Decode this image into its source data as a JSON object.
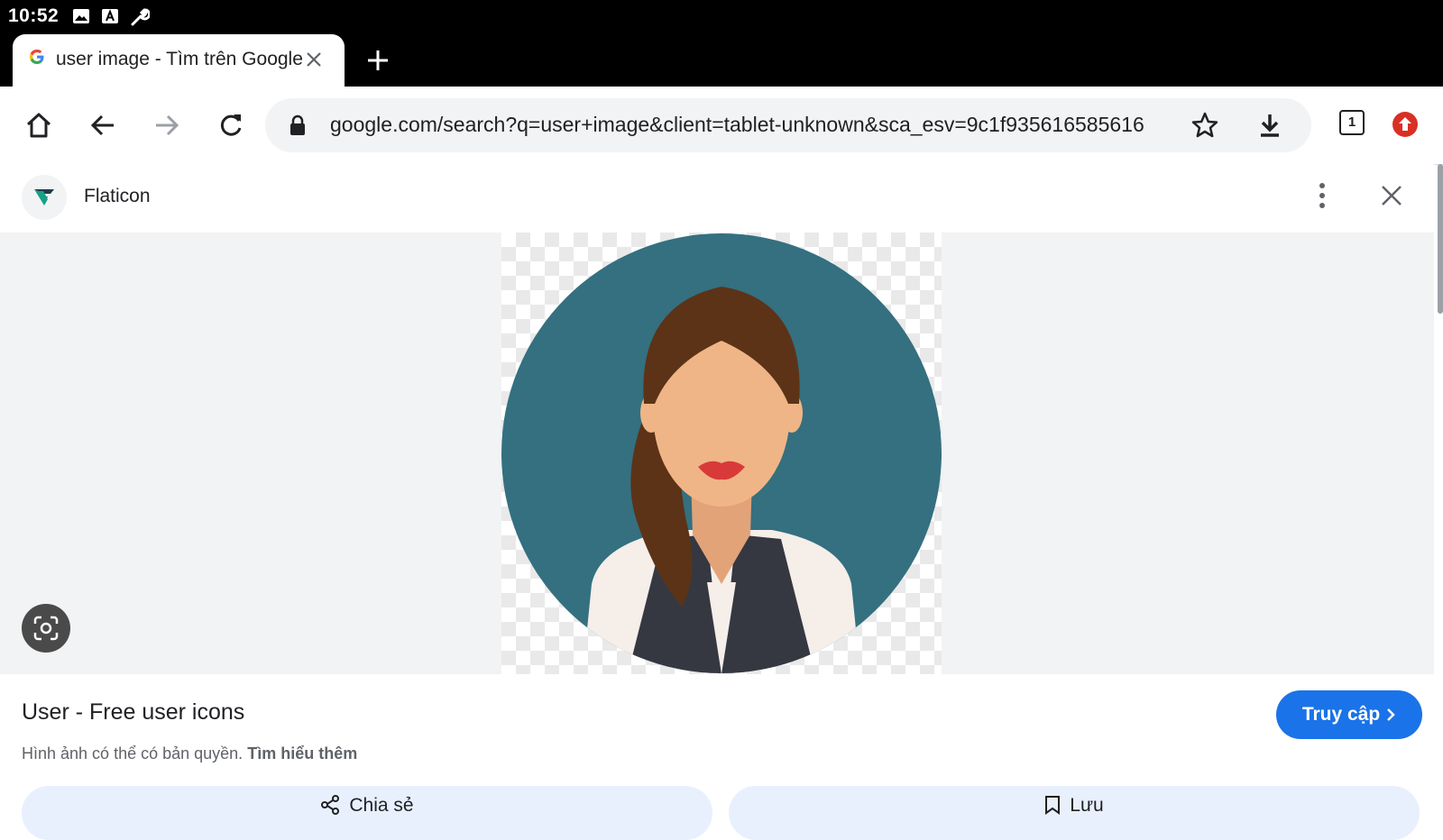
{
  "status": {
    "time": "10:52",
    "icons": [
      "image-icon",
      "font-icon",
      "wrench-icon"
    ]
  },
  "tab": {
    "title": "user image - Tìm trên Google",
    "favicon": "google-g-icon"
  },
  "toolbar": {
    "url": "google.com/search?q=user+image&client=tablet-unknown&sca_esv=9c1f935616585616",
    "tab_count": "1"
  },
  "site": {
    "name": "Flaticon"
  },
  "image_info": {
    "title": "User - Free user icons",
    "copyright_text": "Hình ảnh có thể có bản quyền.",
    "learn_more": "Tìm hiểu thêm",
    "visit_label": "Truy cập"
  },
  "actions": {
    "share_label": "Chia sẻ",
    "save_label": "Lưu"
  },
  "colors": {
    "accent": "#1a73e8",
    "avatar_bg": "#347080",
    "hair": "#5c3317",
    "skin": "#f0b586"
  }
}
